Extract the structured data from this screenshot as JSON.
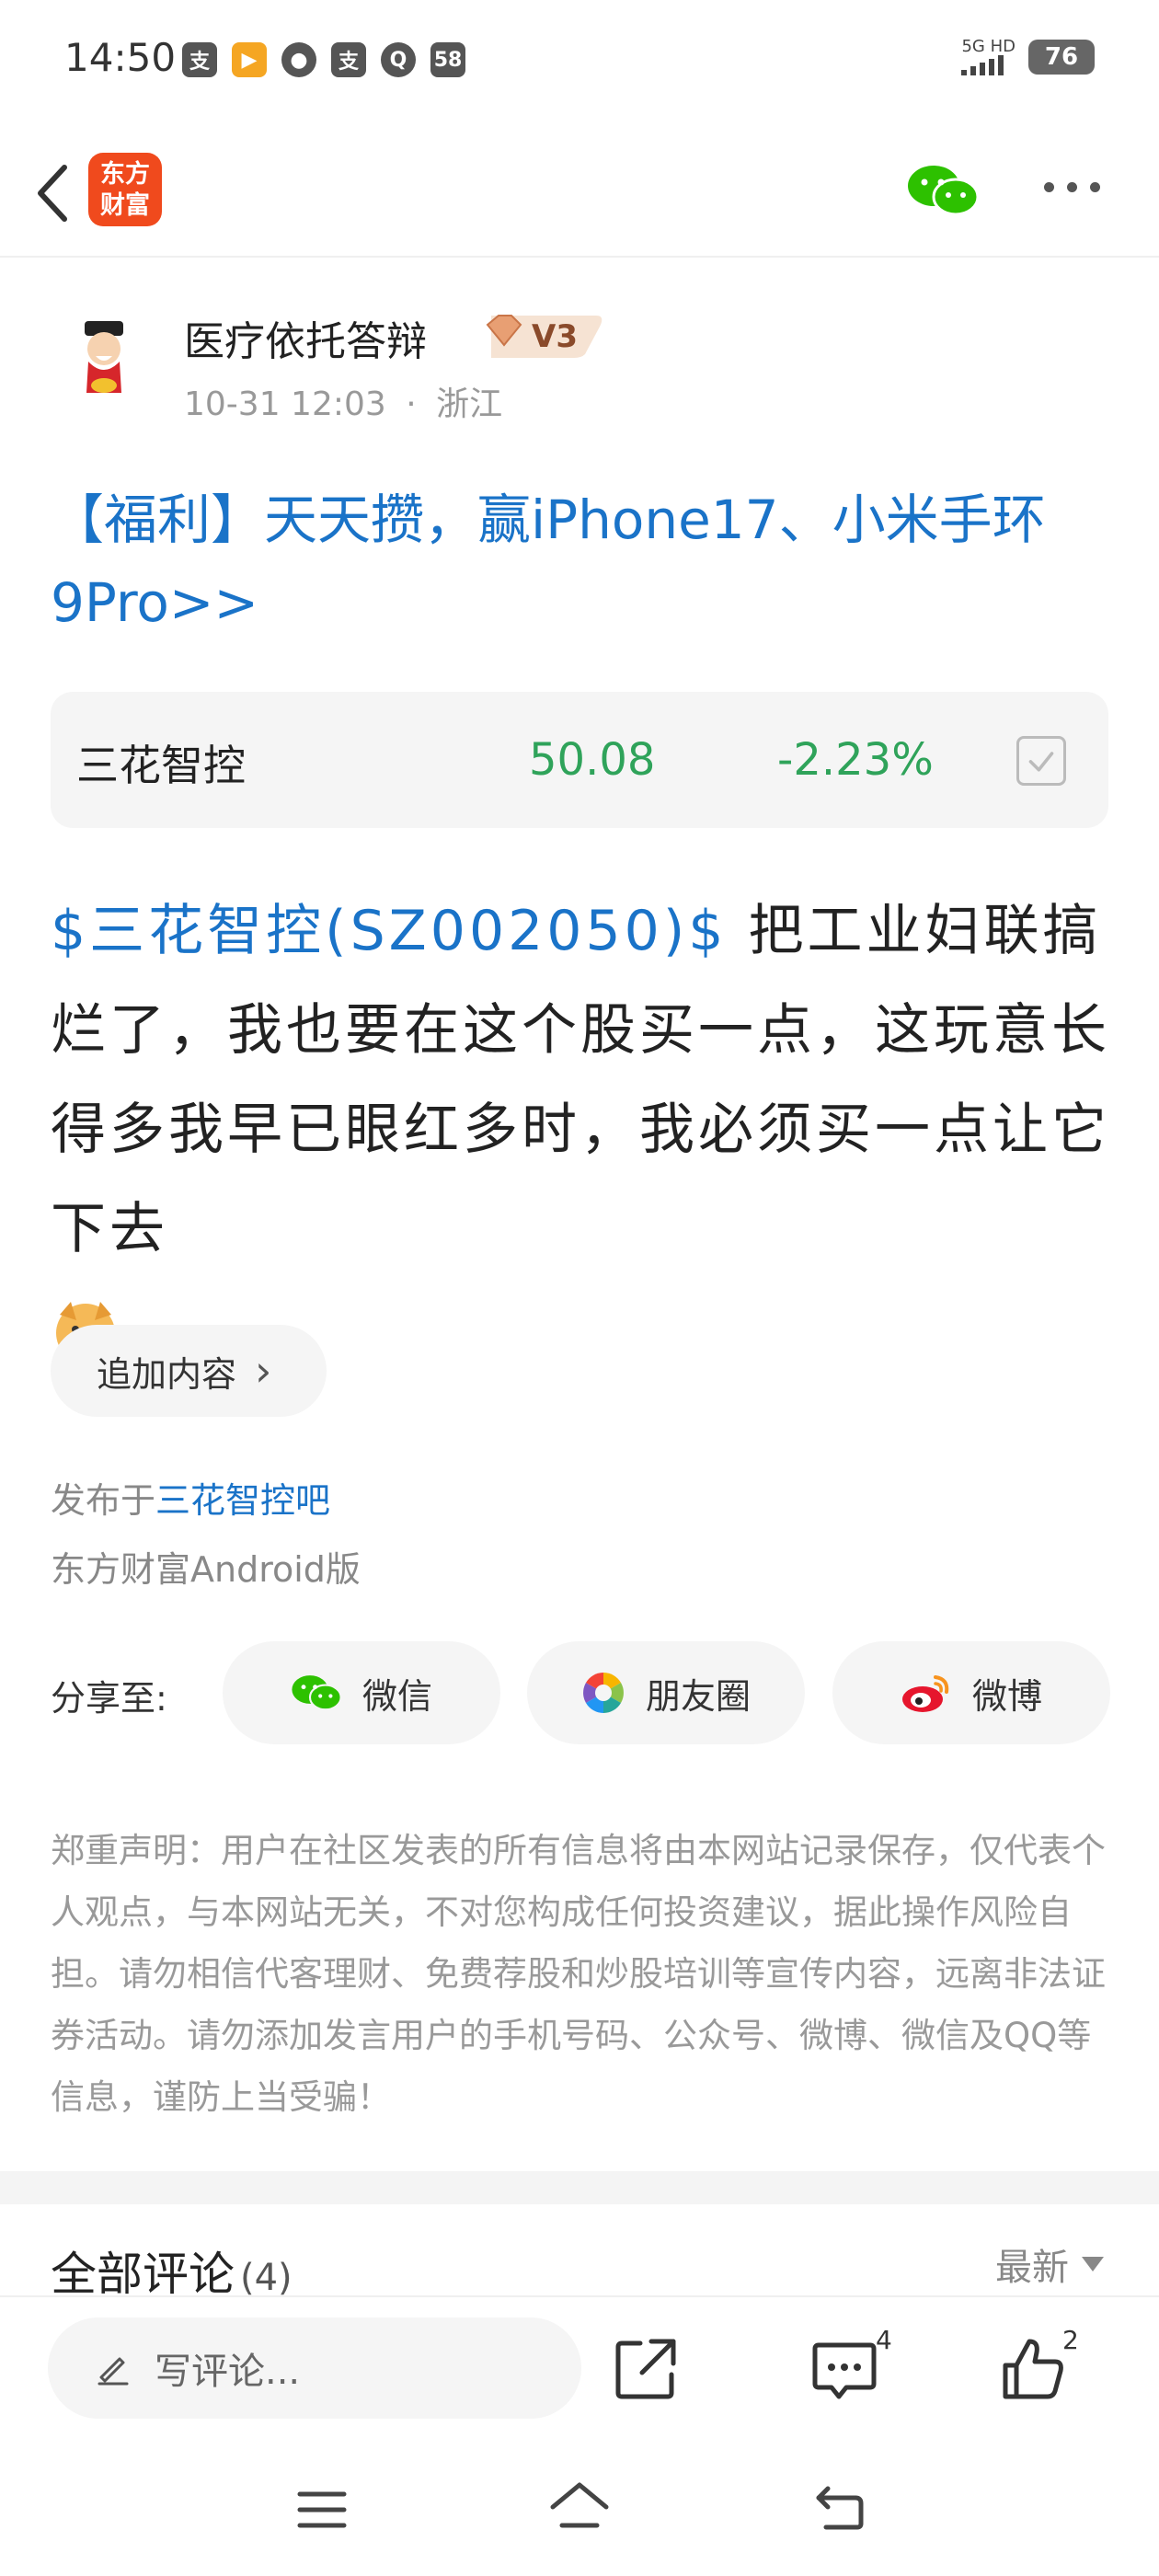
{
  "status_bar": {
    "time": "14:50",
    "notif_count": "58",
    "network": "5G HD",
    "battery": "76"
  },
  "nav": {
    "logo_line1": "东方",
    "logo_line2": "财富"
  },
  "author": {
    "name": "医疗依托答辩",
    "level": "V3",
    "date": "10-31 12:03",
    "separator": "·",
    "location": "浙江"
  },
  "promo": {
    "text": "【福利】天天攒，赢iPhone17、小米手环9Pro>>"
  },
  "stock_card": {
    "name": "三花智控",
    "price": "50.08",
    "change": "-2.23%"
  },
  "post": {
    "stock_link": "$三花智控(SZ002050)$",
    "text": " 把工业妇联搞烂了，我也要在这个股买一点，这玩意长得多我早已眼红多时，我必须买一点让它下去"
  },
  "append": {
    "label": "追加内容",
    "chevron": "›"
  },
  "meta": {
    "published_prefix": "发布于",
    "bar_name": "三花智控吧",
    "client": "东方财富Android版"
  },
  "share": {
    "label": "分享至:",
    "wechat": "微信",
    "moments": "朋友圈",
    "weibo": "微博"
  },
  "disclaimer": "郑重声明：用户在社区发表的所有信息将由本网站记录保存，仅代表个人观点，与本网站无关，不对您构成任何投资建议，据此操作风险自担。请勿相信代客理财、免费荐股和炒股培训等宣传内容，远离非法证券活动。请勿添加发言用户的手机号码、公众号、微博、微信及QQ等信息，谨防上当受骗！",
  "comments": {
    "title": "全部评论",
    "count": "(4)",
    "sort": "最新"
  },
  "toolbar": {
    "placeholder": "写评论...",
    "comment_count": "4",
    "like_count": "2"
  },
  "colors": {
    "link_blue": "#1a73c8",
    "green_down": "#2fa35a",
    "brand_orange": "#f04a1d"
  }
}
